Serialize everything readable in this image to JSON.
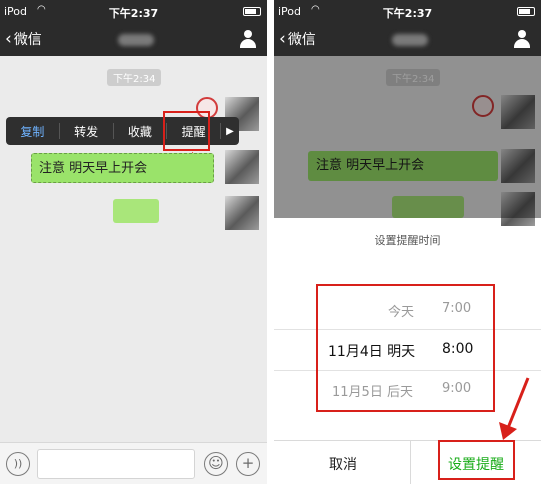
{
  "status_bar": {
    "carrier": "iPod",
    "wifi_icon": "wifi-icon",
    "time": "下午2:37"
  },
  "nav": {
    "back_label": "微信",
    "back_icon": "chevron-left-icon",
    "profile_icon": "person-icon"
  },
  "chat": {
    "timestamp": "下午2:34",
    "message_text": "注意 明天早上开会"
  },
  "context_menu": {
    "items": [
      "复制",
      "转发",
      "收藏",
      "提醒"
    ],
    "more_icon": "triangle-right-icon"
  },
  "input_bar": {
    "voice_icon": "voice-icon",
    "emoji_icon": "emoji-icon",
    "plus_icon": "plus-icon"
  },
  "reminder_sheet": {
    "title": "设置提醒时间",
    "picker": {
      "dates": [
        "今天",
        "11月4日 明天",
        "11月5日 后天"
      ],
      "times": [
        "7:00",
        "8:00",
        "9:00"
      ],
      "selected_date": "11月4日 明天",
      "selected_time": "8:00"
    },
    "cancel_label": "取消",
    "confirm_label": "设置提醒"
  },
  "colors": {
    "accent_green": "#1aac19",
    "bubble_green": "#9ae36a",
    "annotation_red": "#d8201a",
    "bar_dark": "#2b2b2b"
  }
}
